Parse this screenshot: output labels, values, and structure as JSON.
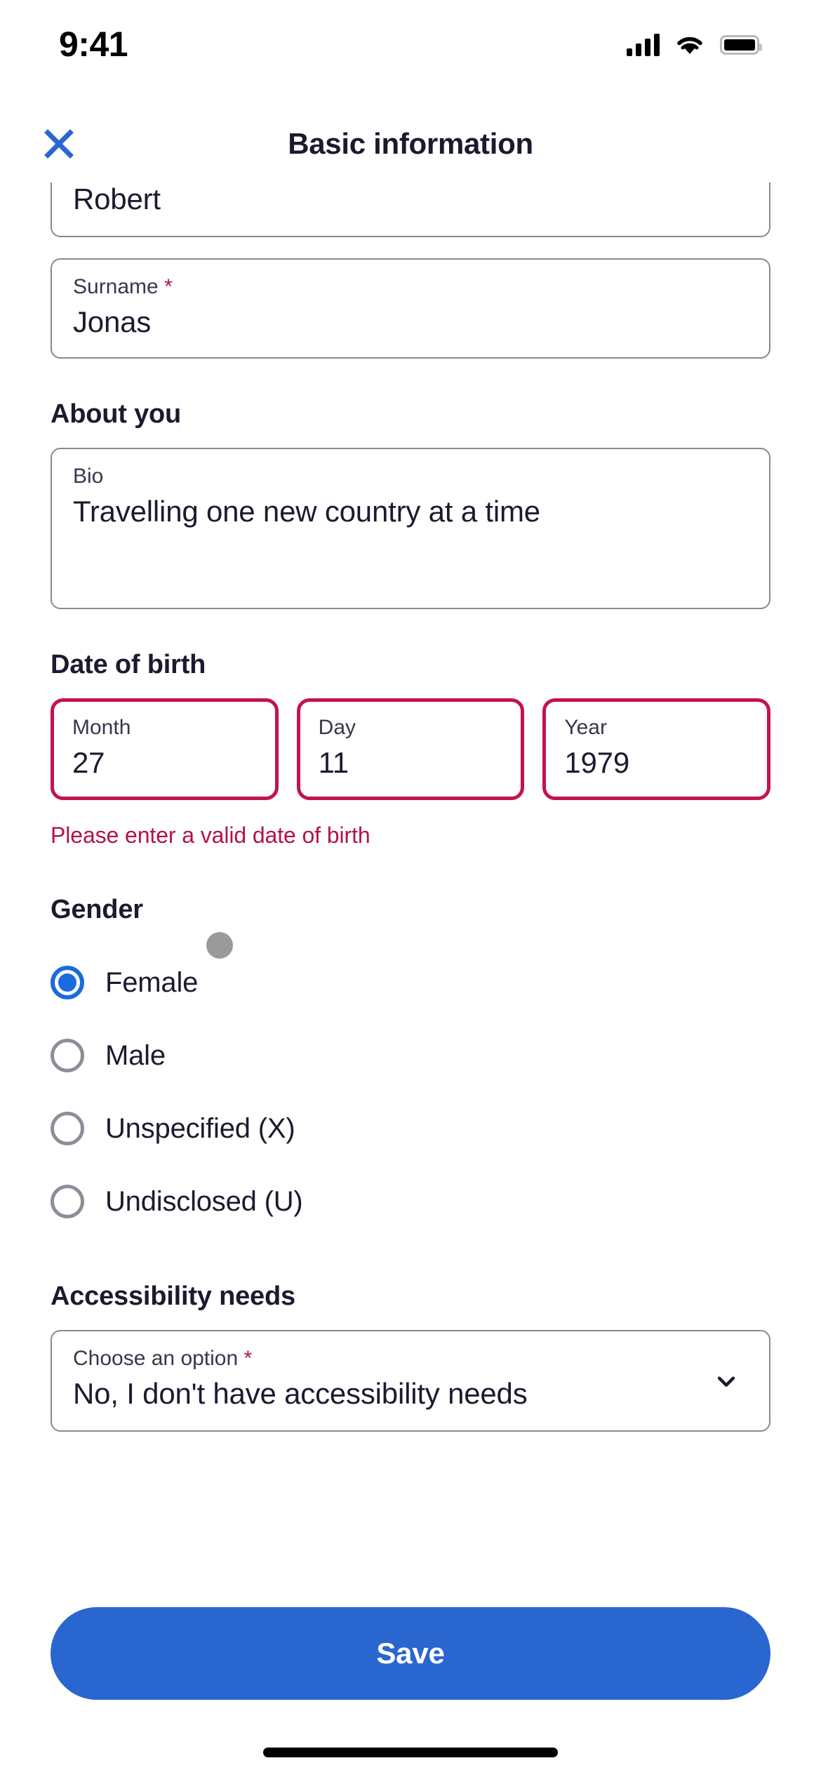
{
  "status_bar": {
    "time": "9:41",
    "signal_icon": "signal-bars-icon",
    "wifi_icon": "wifi-icon",
    "battery_icon": "battery-full-icon"
  },
  "header": {
    "close_icon": "close-x-icon",
    "title": "Basic information"
  },
  "name_section": {
    "first_name": {
      "label": "",
      "value": "Robert"
    },
    "surname": {
      "label": "Surname",
      "required_marker": "*",
      "value": "Jonas"
    }
  },
  "about_you": {
    "heading": "About you",
    "bio": {
      "label": "Bio",
      "value": "Travelling one new country at a time"
    }
  },
  "date_of_birth": {
    "heading": "Date of birth",
    "month": {
      "label": "Month",
      "value": "27"
    },
    "day": {
      "label": "Day",
      "value": "11"
    },
    "year": {
      "label": "Year",
      "value": "1979"
    },
    "error": "Please enter a valid date of birth"
  },
  "gender": {
    "heading": "Gender",
    "options": [
      {
        "label": "Female",
        "selected": true
      },
      {
        "label": "Male",
        "selected": false
      },
      {
        "label": "Unspecified (X)",
        "selected": false
      },
      {
        "label": "Undisclosed (U)",
        "selected": false
      }
    ]
  },
  "accessibility": {
    "heading": "Accessibility needs",
    "select": {
      "label": "Choose an option",
      "required_marker": "*",
      "value": "No, I don't have accessibility needs",
      "chevron_icon": "chevron-down-icon"
    }
  },
  "footer": {
    "save_label": "Save"
  },
  "colors": {
    "accent_blue": "#2a66cf",
    "error_crimson": "#c4114f",
    "error_text": "#b3124b",
    "text_dark": "#1b1b2f",
    "border_gray": "#8a8a8a",
    "touch_dot_gray": "#9a9a9a"
  }
}
